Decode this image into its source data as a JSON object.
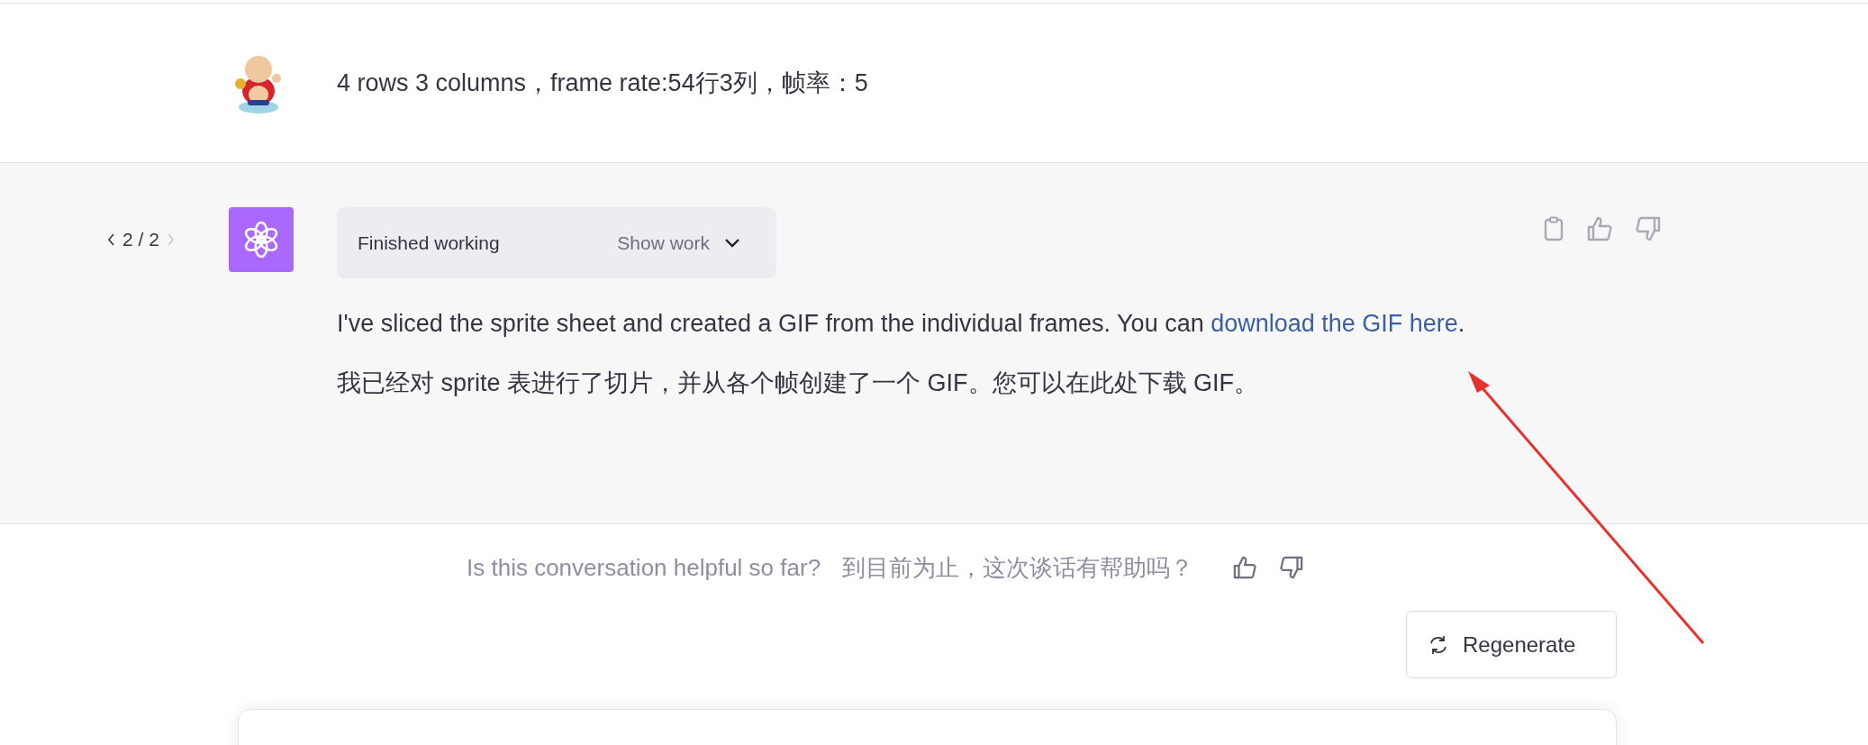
{
  "user_message": {
    "text": "4 rows 3 columns，frame rate:54行3列，帧率：5"
  },
  "assistant_message": {
    "pager": {
      "text": "2 / 2",
      "prev_disabled": false,
      "next_disabled": true
    },
    "work_status": {
      "label": "Finished working",
      "toggle": "Show work",
      "expanded": false
    },
    "paragraphs": [
      {
        "text": "I've sliced the sprite sheet and created a GIF from the individual frames. You can ",
        "link": "download the GIF here",
        "after": "."
      },
      {
        "text": "我已经对 sprite 表进行了切片，并从各个帧创建了一个 GIF。您可以在此处下载 GIF。"
      }
    ]
  },
  "feedback": {
    "question": "Is this conversation helpful so far?",
    "question_translation": "到目前为止，这次谈话有帮助吗？"
  },
  "regenerate_button": {
    "label": "Regenerate"
  },
  "annotations": [
    {
      "kind": "arrow"
    }
  ]
}
